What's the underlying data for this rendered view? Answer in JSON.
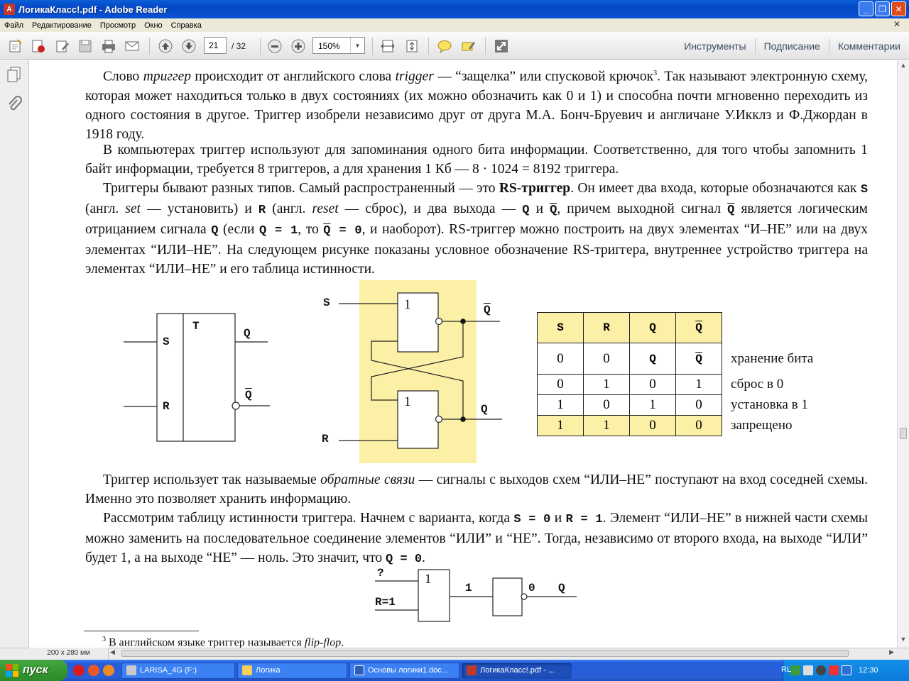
{
  "window": {
    "title": "ЛогикаКласс!.pdf - Adobe Reader",
    "app_icon": "adobe-reader-icon"
  },
  "menu": [
    "Файл",
    "Редактирование",
    "Просмотр",
    "Окно",
    "Справка"
  ],
  "toolbar": {
    "page_current": "21",
    "page_total": "/ 32",
    "zoom": "150%",
    "tabs": [
      "Инструменты",
      "Подписание",
      "Комментарии"
    ]
  },
  "statusbar": {
    "page_size": "200 x 280 мм"
  },
  "document": {
    "p1": {
      "a": "Слово ",
      "b": "триггер",
      "c": " происходит от английского слова ",
      "d": "trigger",
      "e": " — “защелка” или спусковой крючок",
      "f": "3",
      "g": ". Так называют электронную схему, которая может находиться только в двух состояниях (их можно обозначить как 0 и 1) и способна почти мгновенно переходить из одного состояния в другое. Триггер изобрели независимо друг от друга М.А. Бонч-Бруевич и англичане У.Икклз и Ф.Джордан в 1918 году."
    },
    "p2": "В компьютерах триггер используют для запоминания одного бита информации. Соответственно, для того чтобы запомнить 1 байт информации, требуется 8 триггеров, а для хранения 1 Кб — 8 · 1024 = 8192 триггера.",
    "p3": {
      "a": "Триггеры бывают разных типов. Самый распространенный — это ",
      "b": "RS-триггер",
      "c": ". Он имеет два входа, которые обозначаются как ",
      "d": "S",
      "e": " (англ. ",
      "f": "set",
      "g": " — установить) и ",
      "h": "R",
      "i": " (англ. ",
      "j": "reset",
      "k": " — сброс), и два выхода — ",
      "l": "Q",
      "m": " и ",
      "n": "Q",
      "o": ", причем выходной сигнал ",
      "p": "Q",
      "q": " является логическим отрицанием сигнала ",
      "r": "Q",
      "s": "  (если ",
      "t": "Q = 1",
      "u": ", то ",
      "v": "Q",
      "w": " = 0",
      "x": ", и наоборот). RS-триггер можно построить на двух элементах “И–НЕ” или на двух элементах “ИЛИ–НЕ”. На следующем рисунке показаны условное обозначение RS-триггера, внутреннее устройство триггера на элементах “ИЛИ–НЕ” и его таблица истинности."
    },
    "fig1": {
      "t": "T",
      "s": "S",
      "r": "R",
      "q": "Q",
      "qbar": "Q"
    },
    "fig2": {
      "s": "S",
      "r": "R",
      "g1": "1",
      "g2": "1",
      "qbar": "Q",
      "q": "Q"
    },
    "truth_table": {
      "headers": [
        "S",
        "R",
        "Q",
        "Q"
      ],
      "rows": [
        {
          "c": [
            "0",
            "0",
            "Q",
            "Q"
          ],
          "comment": "хранение бита"
        },
        {
          "c": [
            "0",
            "1",
            "0",
            "1"
          ],
          "comment": "сброс в 0"
        },
        {
          "c": [
            "1",
            "0",
            "1",
            "0"
          ],
          "comment": "установка в 1"
        },
        {
          "c": [
            "1",
            "1",
            "0",
            "0"
          ],
          "comment": "запрещено"
        }
      ]
    },
    "p4": {
      "a": "Триггер использует так называемые ",
      "b": "обратные связи",
      "c": " — сигналы с выходов схем “ИЛИ–НЕ” поступают на вход соседней схемы. Именно это позволяет хранить информацию."
    },
    "p5": {
      "a": "Рассмотрим таблицу истинности триггера. Начнем с варианта, когда ",
      "b": "S = 0",
      "c": " и ",
      "d": "R = 1",
      "e": ". Элемент “ИЛИ–НЕ” в нижней части схемы можно заменить на последовательное соединение элементов “ИЛИ” и “НЕ”. Тогда, независимо от второго входа, на выходе “ИЛИ” будет 1, а на выходе “НЕ” — ноль. Это значит, что ",
      "f": "Q = 0",
      "g": "."
    },
    "fig3": {
      "q_in": "?",
      "r_in": "R=1",
      "g1": "1",
      "mid": "1",
      "out": "0",
      "q": "Q"
    },
    "footnote": {
      "num": "3",
      "a": " В английском языке триггер называется ",
      "b": "flip-flop",
      "c": "."
    }
  },
  "taskbar": {
    "start": "пуск",
    "tasks": [
      "LARISA_4G (F:)",
      "Логика",
      "Основы логики1.doc...",
      "ЛогикаКласс!.pdf - ..."
    ],
    "lang": "RL",
    "clock": "12:30"
  }
}
